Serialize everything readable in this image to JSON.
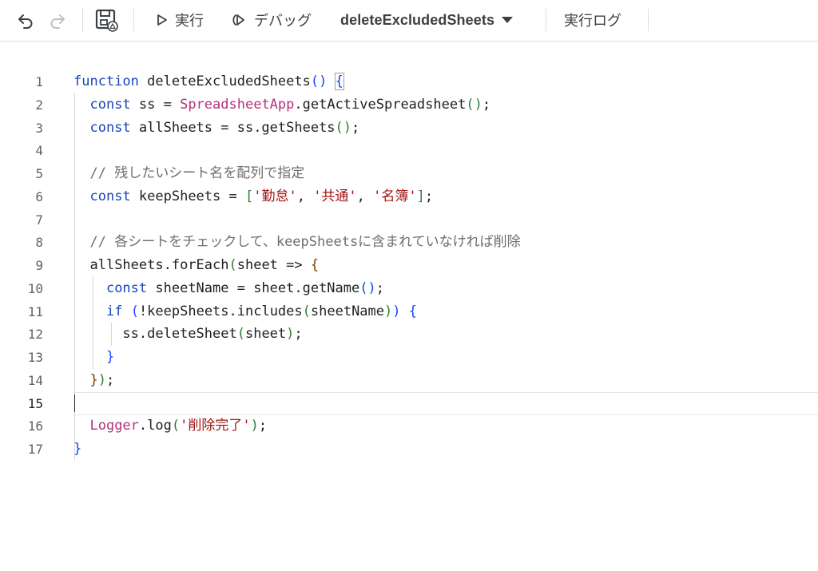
{
  "toolbar": {
    "undo_icon": "undo-icon",
    "redo_icon": "redo-icon",
    "save_icon": "save-to-drive-icon",
    "run_label": "実行",
    "debug_label": "デバッグ",
    "function_selected": "deleteExcludedSheets",
    "log_label": "実行ログ"
  },
  "editor": {
    "line_numbers": [
      "1",
      "2",
      "3",
      "4",
      "5",
      "6",
      "7",
      "8",
      "9",
      "10",
      "11",
      "12",
      "13",
      "14",
      "15",
      "16",
      "17"
    ],
    "active_line": 15,
    "lines": [
      [
        [
          "kw",
          "function"
        ],
        [
          "id",
          " deleteExcludedSheets"
        ],
        [
          "p1",
          "()"
        ],
        [
          "pn",
          " "
        ],
        [
          "p1",
          "{"
        ]
      ],
      [
        [
          "pn",
          "  "
        ],
        [
          "kw",
          "const"
        ],
        [
          "id",
          " ss = "
        ],
        [
          "cls",
          "SpreadsheetApp"
        ],
        [
          "id",
          ".getActiveSpreadsheet"
        ],
        [
          "p2",
          "()"
        ],
        [
          "pn",
          ";"
        ]
      ],
      [
        [
          "pn",
          "  "
        ],
        [
          "kw",
          "const"
        ],
        [
          "id",
          " allSheets = ss.getSheets"
        ],
        [
          "p2",
          "()"
        ],
        [
          "pn",
          ";"
        ]
      ],
      [],
      [
        [
          "pn",
          "  "
        ],
        [
          "com",
          "// 残したいシート名を配列で指定"
        ]
      ],
      [
        [
          "pn",
          "  "
        ],
        [
          "kw",
          "const"
        ],
        [
          "id",
          " keepSheets = "
        ],
        [
          "p2",
          "["
        ],
        [
          "str",
          "'勤怠'"
        ],
        [
          "pn",
          ", "
        ],
        [
          "str",
          "'共通'"
        ],
        [
          "pn",
          ", "
        ],
        [
          "str",
          "'名簿'"
        ],
        [
          "p2",
          "]"
        ],
        [
          "pn",
          ";"
        ]
      ],
      [],
      [
        [
          "pn",
          "  "
        ],
        [
          "com",
          "// 各シートをチェックして、keepSheetsに含まれていなければ削除"
        ]
      ],
      [
        [
          "pn",
          "  "
        ],
        [
          "id",
          "allSheets.forEach"
        ],
        [
          "p2",
          "("
        ],
        [
          "id",
          "sheet => "
        ],
        [
          "p3",
          "{"
        ]
      ],
      [
        [
          "pn",
          "    "
        ],
        [
          "kw",
          "const"
        ],
        [
          "id",
          " sheetName = sheet.getName"
        ],
        [
          "p1",
          "()"
        ],
        [
          "pn",
          ";"
        ]
      ],
      [
        [
          "pn",
          "    "
        ],
        [
          "kw",
          "if"
        ],
        [
          "pn",
          " "
        ],
        [
          "p1",
          "("
        ],
        [
          "id",
          "!keepSheets.includes"
        ],
        [
          "p2",
          "("
        ],
        [
          "id",
          "sheetName"
        ],
        [
          "p2",
          ")"
        ],
        [
          "p1",
          ")"
        ],
        [
          "pn",
          " "
        ],
        [
          "p1",
          "{"
        ]
      ],
      [
        [
          "pn",
          "      "
        ],
        [
          "id",
          "ss.deleteSheet"
        ],
        [
          "p2",
          "("
        ],
        [
          "id",
          "sheet"
        ],
        [
          "p2",
          ")"
        ],
        [
          "pn",
          ";"
        ]
      ],
      [
        [
          "pn",
          "    "
        ],
        [
          "p1",
          "}"
        ]
      ],
      [
        [
          "pn",
          "  "
        ],
        [
          "p3",
          "}"
        ],
        [
          "p2",
          ")"
        ],
        [
          "pn",
          ";"
        ]
      ],
      [],
      [
        [
          "pn",
          "  "
        ],
        [
          "cls",
          "Logger"
        ],
        [
          "id",
          ".log"
        ],
        [
          "p2",
          "("
        ],
        [
          "str",
          "'削除完了'"
        ],
        [
          "p2",
          ")"
        ],
        [
          "pn",
          ";"
        ]
      ],
      [
        [
          "p1",
          "}"
        ]
      ]
    ]
  },
  "colors": {
    "keyword": "#1a44b8",
    "class": "#b5327f",
    "string": "#a31515",
    "comment": "#6e6e6e",
    "bracket1": "#1a44ff",
    "bracket2": "#2e7d32",
    "bracket3": "#7b3f00"
  }
}
